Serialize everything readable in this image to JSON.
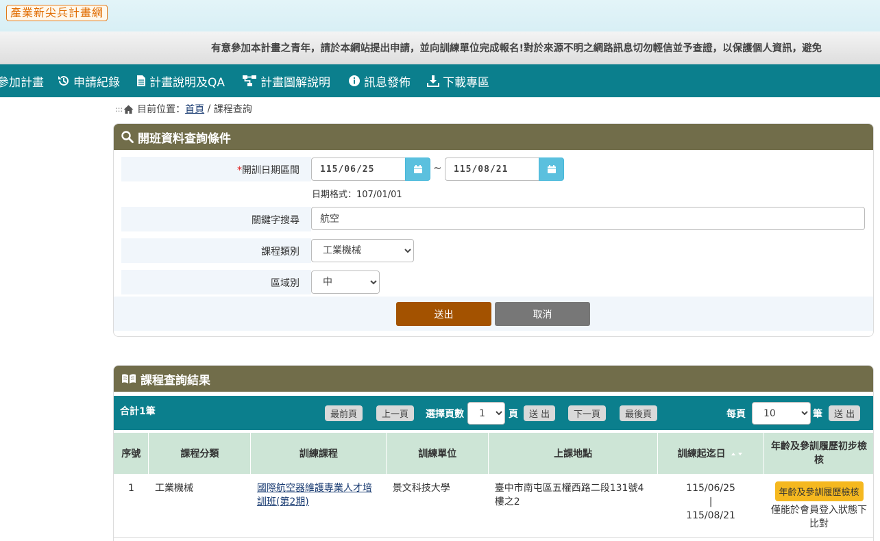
{
  "header": {
    "logo": "產業新尖兵計畫網"
  },
  "marquee": {
    "text": "有意參加本計畫之青年，請於本網站提出申請，並向訓練單位完成報名!對於來源不明之網路訊息切勿輕信並予查證，以保護個人資訊，避免"
  },
  "nav": {
    "items": [
      {
        "label": "參加計畫"
      },
      {
        "label": "申請紀錄"
      },
      {
        "label": "計畫說明及QA"
      },
      {
        "label": "計畫圖解說明"
      },
      {
        "label": "訊息發佈"
      },
      {
        "label": "下載專區"
      }
    ]
  },
  "breadcrumb": {
    "prefix": ":::",
    "label": "目前位置：",
    "home": "首頁",
    "sep": " / ",
    "current": "課程查詢"
  },
  "search": {
    "title": "開班資料查詢條件",
    "date_label": "開訓日期區間",
    "required_mark": "*",
    "date_start": "115/06/25",
    "date_end": "115/08/21",
    "tilde": "~",
    "date_hint": "日期格式：107/01/01",
    "keyword_label": "關鍵字搜尋",
    "keyword_value": "航空",
    "category_label": "課程類別",
    "category_value": "工業機械",
    "region_label": "區域別",
    "region_value": "中",
    "submit_label": "送出",
    "cancel_label": "取消"
  },
  "results": {
    "title": "課程查詢結果",
    "total": "合計1筆",
    "first_page": "最前頁",
    "prev_page": "上一頁",
    "select_page_label": "選擇頁數",
    "page_value": "1",
    "page_unit": "頁",
    "go_label": "送 出",
    "next_page": "下一頁",
    "last_page": "最後頁",
    "per_page_label": "每頁",
    "per_page_value": "10",
    "per_page_unit": "筆",
    "per_page_go": "送 出",
    "columns": [
      "序號",
      "課程分類",
      "訓練課程",
      "訓練單位",
      "上課地點",
      "訓練起迄日",
      "年齡及參訓履歷初步檢核"
    ],
    "rows": [
      {
        "no": "1",
        "category": "工業機械",
        "course": "國際航空器維護專業人才培訓班(第2期)",
        "unit": "景文科技大學",
        "location": "臺中市南屯區五權西路二段131號4樓之2",
        "start": "115/06/25",
        "sep": "|",
        "end": "115/08/21",
        "check_button": "年齡及參訓履歷檢核",
        "check_note": "僅能於會員登入狀態下比對"
      }
    ]
  },
  "colors": {
    "nav": "#0b7f8d",
    "panel_head": "#716d4a",
    "submit": "#a35200",
    "cancel": "#777777",
    "check": "#f5b81f"
  }
}
